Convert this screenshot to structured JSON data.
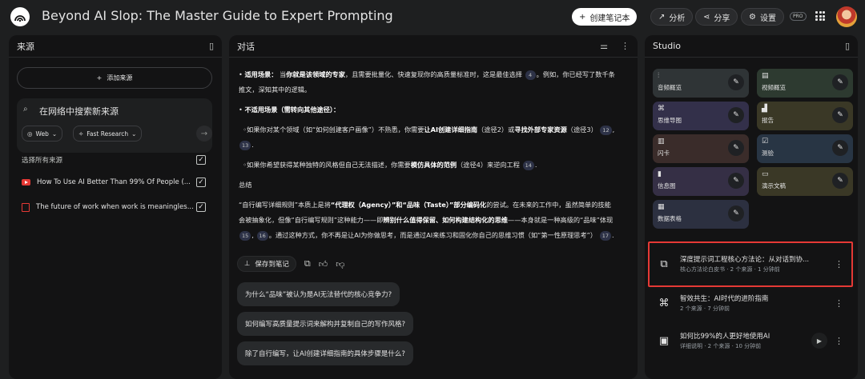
{
  "header": {
    "title": "Beyond AI Slop: The Master Guide to Expert Prompting",
    "create_notebook": "创建笔记本",
    "analyze": "分析",
    "share": "分享",
    "settings": "设置",
    "pro_badge": "PRO"
  },
  "sources": {
    "title": "来源",
    "add_button": "添加来源",
    "search_placeholder": "在网络中搜索新来源",
    "chip_web": "Web",
    "chip_research": "Fast Research",
    "select_all": "选择所有来源",
    "items": [
      {
        "title": "How To Use AI Better Than 99% Of People (...",
        "type": "youtube"
      },
      {
        "title": "The future of work when work is meaningles...",
        "type": "document"
      }
    ]
  },
  "chat": {
    "title": "对话",
    "line1_label": "适用场景：",
    "line1_a": "当",
    "line1_b": "你就是该领域的专家",
    "line1_c": "，且需要批量化、快速复现你的高质量标准时，这是最佳选择",
    "line1_ref": "4",
    "line1_d": "。例如，你已经写了数千条推文，深知其中的逻辑。",
    "line2_label": "不适用场景（需转向其他途径）：",
    "line3_a": "◦如果你对某个领域（如“如何创建客户画像”）不熟悉，你需要",
    "line3_b": "让AI创建详细指南",
    "line3_c": "（途径2）或",
    "line3_d": "寻找外部专家资源",
    "line3_e": "（途径3）",
    "line3_ref1": "12",
    "line3_ref2": "13",
    "line4_a": "◦如果你希望获得某种独特的风格但自己无法描述，你需要",
    "line4_b": "模仿具体的范例",
    "line4_c": "（途径4）来逆向工程",
    "line4_ref": "14",
    "summary_title": "总结",
    "summary_a": "“自行编写详细规则”本质上是将",
    "summary_b": "“代理权（Agency）”和“品味（Taste）”部分编码化",
    "summary_c": "的尝试。在未来的工作中，虽然简单的技能会被抽象化，但像“自行编写规则”这种能力——即",
    "summary_d": "辨别什么值得保留、如何构建结构化的思维",
    "summary_e": "——本身就是一种高级的“品味”体现",
    "summary_ref1": "15",
    "summary_ref2": "16",
    "summary_f": "。通过这种方式，你不再是让AI为你做思考，而是通过AI来练习和固化你自己的思维习惯（如“第一性原理思考”）",
    "summary_ref3": "17",
    "save_note": "保存到笔记",
    "suggestions": [
      "为什么“品味”被认为是AI无法替代的核心竞争力?",
      "如何编写高质量提示词来解构并复制自己的写作风格?",
      "除了自行编写，让AI创建详细指南的具体步骤是什么?"
    ]
  },
  "studio": {
    "title": "Studio",
    "tiles": [
      {
        "label": "音频概览",
        "icon": "audio-icon",
        "color": "#2f3436"
      },
      {
        "label": "视频概览",
        "icon": "video-icon",
        "color": "#2d3a30"
      },
      {
        "label": "思维导图",
        "icon": "mindmap-icon",
        "color": "#33304a"
      },
      {
        "label": "报告",
        "icon": "report-icon",
        "color": "#3a3826"
      },
      {
        "label": "闪卡",
        "icon": "flashcard-icon",
        "color": "#3a2c2a"
      },
      {
        "label": "测验",
        "icon": "quiz-icon",
        "color": "#283544"
      },
      {
        "label": "信息图",
        "icon": "infographic-icon",
        "color": "#352f45"
      },
      {
        "label": "演示文稿",
        "icon": "slides-icon",
        "color": "#3a3826"
      },
      {
        "label": "数据表格",
        "icon": "table-icon",
        "color": "#2c3040"
      }
    ],
    "notes": [
      {
        "title": "深度提示词工程核心方法论：从对话到协...",
        "meta": "核心方法论白皮书 · 2 个来源 · 1 分钟前"
      },
      {
        "title": "智效共生：AI时代的进阶指南",
        "meta": "2 个来源 · 7 分钟前"
      },
      {
        "title": "如何比99%的人更好地使用AI",
        "meta": "详细说明 · 2 个来源 · 10 分钟前"
      }
    ]
  }
}
